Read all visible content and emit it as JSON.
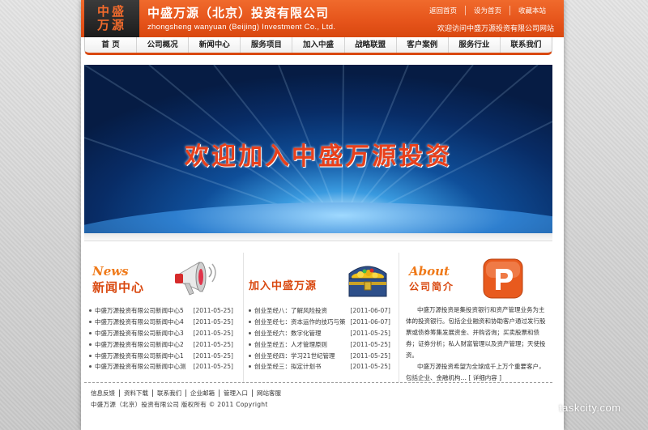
{
  "header": {
    "logo_line1": "中盛",
    "logo_line2": "万源",
    "company_name": "中盛万源（北京）投资有限公司",
    "company_en": "zhongsheng wanyuan (Beijing) Investment Co., Ltd.",
    "top_links": [
      "返回首页",
      "设为首页",
      "收藏本站"
    ],
    "welcome": "欢迎访问中盛万源投资有限公司网站"
  },
  "nav": {
    "items": [
      "首 页",
      "公司概况",
      "新闻中心",
      "服务项目",
      "加入中盛",
      "战略联盟",
      "客户案例",
      "服务行业",
      "联系我们"
    ]
  },
  "banner": {
    "text": "欢迎加入中盛万源投资"
  },
  "news": {
    "title_en": "News",
    "title_cn": "新闻中心",
    "items": [
      {
        "title": "中盛万源投资有限公司新闻中心5",
        "date": "[2011-05-25]"
      },
      {
        "title": "中盛万源投资有限公司新闻中心4",
        "date": "[2011-05-25]"
      },
      {
        "title": "中盛万源投资有限公司新闻中心3",
        "date": "[2011-05-25]"
      },
      {
        "title": "中盛万源投资有限公司新闻中心2",
        "date": "[2011-05-25]"
      },
      {
        "title": "中盛万源投资有限公司新闻中心1",
        "date": "[2011-05-25]"
      },
      {
        "title": "中盛万源投资有限公司新闻中心测",
        "date": "[2011-05-25]"
      }
    ]
  },
  "join": {
    "title": "加入中盛万源",
    "items": [
      {
        "title": "创业圣经八：了解风险投资",
        "date": "[2011-06-07]"
      },
      {
        "title": "创业圣经七：资本运作的技巧与策",
        "date": "[2011-06-07]"
      },
      {
        "title": "创业圣经六：数字化管理",
        "date": "[2011-05-25]"
      },
      {
        "title": "创业圣经五：人才管理原则",
        "date": "[2011-05-25]"
      },
      {
        "title": "创业圣经四：学习21世纪管理",
        "date": "[2011-05-25]"
      },
      {
        "title": "创业圣经三：拟定计划书",
        "date": "[2011-05-25]"
      }
    ]
  },
  "about": {
    "title_en": "About",
    "title_cn": "公司简介",
    "para1": "中盛万源投资是集投资银行和资产管理业务为主体的投资银行。包括企业融资和协助客户通过发行股票或债券筹集发展资金、并购咨询；买卖股票和债券；证券分析；私人财富管理以及资产管理；天使投资。",
    "para2": "中盛万源投资希望为全球成千上万个重要客户，包括企业、金融机构…",
    "more": "[ 详细内容 ]"
  },
  "footer": {
    "links": [
      "信息反馈",
      "资料下载",
      "联系我们",
      "企业邮箱",
      "管理入口",
      "网站客服"
    ],
    "copyright": "中盛万源（北京）投资有限公司 版权所有 © 2011 Copyright"
  },
  "watermark": "taskcity.com",
  "colors": {
    "brand_orange": "#e5531a",
    "accent_red": "#d9480f",
    "logo_dark": "#1c1c1c"
  }
}
